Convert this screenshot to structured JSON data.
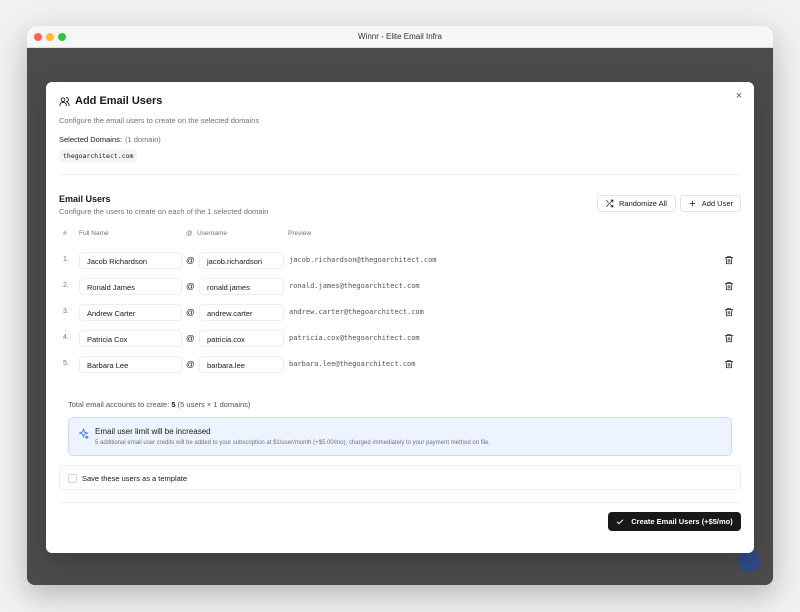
{
  "window": {
    "title": "Winnr - Elite Email Infra"
  },
  "modal": {
    "title": "Add Email Users",
    "subtitle": "Configure the email users to create on the selected domains",
    "selected_domains_label": "Selected Domains:",
    "selected_domains_count": "(1 domain)",
    "domains": [
      "thegoarchitect.com"
    ],
    "close_label": "×"
  },
  "email_users": {
    "title": "Email Users",
    "subtitle": "Configure the users to create on each of the 1 selected domain",
    "randomize_label": "Randomize All",
    "add_user_label": "Add User",
    "columns": {
      "num": "#",
      "full_name": "Full Name",
      "at": "@",
      "username": "Username",
      "preview": "Preview"
    },
    "rows": [
      {
        "num": "1.",
        "full_name": "Jacob Richardson",
        "at": "@",
        "username": "jacob.richardson",
        "preview": "jacob.richardson@thegoarchitect.com"
      },
      {
        "num": "2.",
        "full_name": "Ronald James",
        "at": "@",
        "username": "ronald.james",
        "preview": "ronald.james@thegoarchitect.com"
      },
      {
        "num": "3.",
        "full_name": "Andrew Carter",
        "at": "@",
        "username": "andrew.carter",
        "preview": "andrew.carter@thegoarchitect.com"
      },
      {
        "num": "4.",
        "full_name": "Patricia Cox",
        "at": "@",
        "username": "patricia.cox",
        "preview": "patricia.cox@thegoarchitect.com"
      },
      {
        "num": "5.",
        "full_name": "Barbara Lee",
        "at": "@",
        "username": "barbara.lee",
        "preview": "barbara.lee@thegoarchitect.com"
      }
    ]
  },
  "summary": {
    "label": "Total email accounts to create:",
    "total": "5",
    "detail": "(5 users × 1 domains)"
  },
  "limit_notice": {
    "title": "Email user limit will be increased",
    "description": "5 additional email user credits will be added to your subscription at $1/user/month (+$5.00/mo), charged immediately to your payment method on file."
  },
  "template": {
    "label": "Save these users as a template",
    "checked": false
  },
  "create_button": {
    "label": "Create Email Users (+$5/mo)"
  },
  "colors": {
    "primary": "#18181b",
    "notice_bg": "#eef4ff",
    "notice_border": "#c9dafb",
    "notice_icon": "#3b82f6"
  }
}
